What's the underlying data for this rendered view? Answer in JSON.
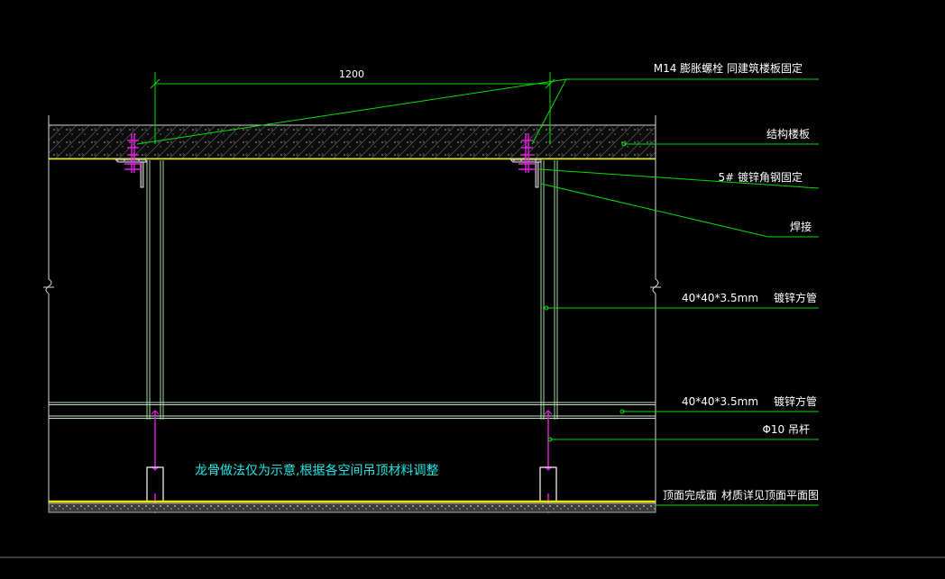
{
  "dimension": {
    "span": "1200"
  },
  "labels": {
    "anchor_bolt": "M14  膨胀螺栓    同建筑楼板固定",
    "structural_slab": "结构楼板",
    "angle_steel": "5#   镀锌角钢固定",
    "welded": "焊接",
    "tube_vertical_size": "40*40*3.5mm",
    "tube_vertical_desc": "镀锌方管",
    "tube_horizontal_size": "40*40*3.5mm",
    "tube_horizontal_desc": "镀锌方管",
    "hanger_rod": "Φ10  吊杆",
    "ceiling_finish": "顶面完成面",
    "ceiling_material": "材质详见顶面平面图"
  },
  "note": "龙骨做法仅为示意,根据各空间吊顶材料调整",
  "colors": {
    "background": "#000000",
    "leader": "#00dd00",
    "frame": "#d8d8d8",
    "tube": "#9bd89b",
    "bolt": "#e61ee6",
    "slab": "#e6e600",
    "note": "#22e6e6"
  }
}
